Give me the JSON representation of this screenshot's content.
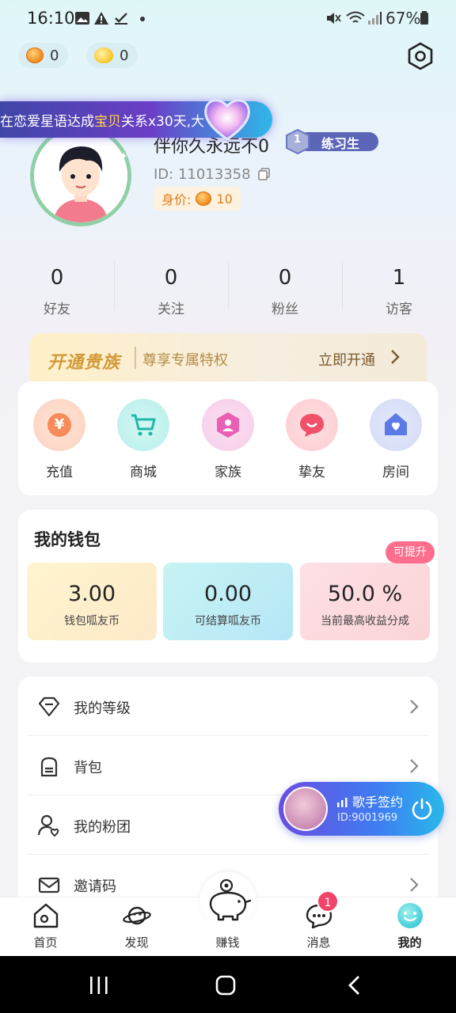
{
  "status_bar": {
    "time": "16:10",
    "battery": "67%"
  },
  "top": {
    "coin_count": "0",
    "duck_count": "0"
  },
  "banner": {
    "prefix": "在恋爱星语达成",
    "highlight": "宝贝",
    "suffix": "关系x30天,大"
  },
  "profile": {
    "nickname": "伴你久永远不0",
    "level_number": "1",
    "level_title": "练习生",
    "user_id": "ID:  11013358",
    "worth_label": "身价:",
    "worth_value": "10"
  },
  "stats": [
    {
      "value": "0",
      "label": "好友"
    },
    {
      "value": "0",
      "label": "关注"
    },
    {
      "value": "0",
      "label": "粉丝"
    },
    {
      "value": "1",
      "label": "访客"
    }
  ],
  "vip": {
    "title": "开通贵族",
    "subtitle": "尊享专属特权",
    "action": "立即开通"
  },
  "menu": [
    {
      "label": "充值",
      "icon": "yuan-icon"
    },
    {
      "label": "商城",
      "icon": "cart-icon"
    },
    {
      "label": "家族",
      "icon": "family-icon"
    },
    {
      "label": "挚友",
      "icon": "chat-heart-icon"
    },
    {
      "label": "房间",
      "icon": "house-icon"
    }
  ],
  "wallet": {
    "title": "我的钱包",
    "upgrade_tag": "可提升",
    "boxes": [
      {
        "value": "3.00",
        "label": "钱包呱友币"
      },
      {
        "value": "0.00",
        "label": "可结算呱友币"
      },
      {
        "value": "50.0 %",
        "label": "当前最高收益分成"
      }
    ]
  },
  "list": [
    {
      "label": "我的等级",
      "icon": "diamond-icon"
    },
    {
      "label": "背包",
      "icon": "backpack-icon"
    },
    {
      "label": "我的粉团",
      "icon": "fan-group-icon"
    },
    {
      "label": "邀请码",
      "icon": "invite-icon"
    }
  ],
  "singer": {
    "title": "歌手签约",
    "id": "ID:9001969"
  },
  "tabs": [
    {
      "label": "首页"
    },
    {
      "label": "发现"
    },
    {
      "label": "赚钱"
    },
    {
      "label": "消息"
    },
    {
      "label": "我的"
    }
  ],
  "message_badge": "1",
  "colors": {
    "accent_pink": "#ff6e8c",
    "badge": "#f0446a",
    "avatar_ring": "#8fd0a6",
    "vip_gold": "#d39a3a"
  }
}
